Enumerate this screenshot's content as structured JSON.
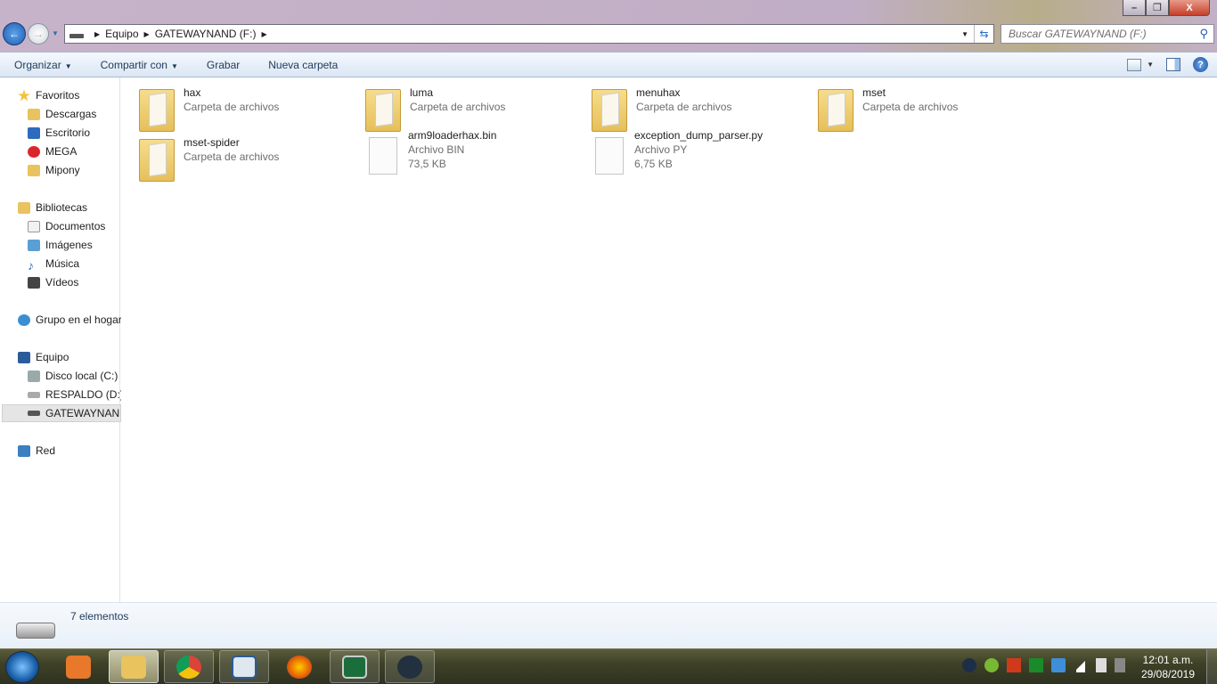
{
  "window": {
    "minimize": "–",
    "maximize": "❐",
    "close": "X"
  },
  "address": {
    "crumbs": [
      "Equipo",
      "GATEWAYNAND (F:)"
    ],
    "search_placeholder": "Buscar GATEWAYNAND (F:)"
  },
  "toolbar": {
    "organize": "Organizar",
    "share": "Compartir con",
    "burn": "Grabar",
    "new_folder": "Nueva carpeta",
    "help": "?"
  },
  "nav": {
    "favorites": "Favoritos",
    "downloads": "Descargas",
    "desktop": "Escritorio",
    "mega": "MEGA",
    "mipony": "Mipony",
    "libraries": "Bibliotecas",
    "documents": "Documentos",
    "images": "Imágenes",
    "music": "Música",
    "videos": "Vídeos",
    "homegroup": "Grupo en el hogar",
    "computer": "Equipo",
    "disk_c": "Disco local (C:)",
    "disk_d": "RESPALDO (D:)",
    "disk_f": "GATEWAYNAND (F:)",
    "network": "Red"
  },
  "files": [
    {
      "name": "hax",
      "type": "Carpeta de archivos",
      "kind": "folder"
    },
    {
      "name": "luma",
      "type": "Carpeta de archivos",
      "kind": "folder"
    },
    {
      "name": "menuhax",
      "type": "Carpeta de archivos",
      "kind": "folder"
    },
    {
      "name": "mset",
      "type": "Carpeta de archivos",
      "kind": "folder"
    },
    {
      "name": "mset-spider",
      "type": "Carpeta de archivos",
      "kind": "folder"
    },
    {
      "name": "arm9loaderhax.bin",
      "type": "Archivo BIN",
      "size": "73,5 KB",
      "kind": "file"
    },
    {
      "name": "exception_dump_parser.py",
      "type": "Archivo PY",
      "size": "6,75 KB",
      "kind": "file"
    }
  ],
  "status": {
    "count": "7 elementos"
  },
  "taskbar": {
    "time": "12:01 a.m.",
    "date": "29/08/2019"
  }
}
